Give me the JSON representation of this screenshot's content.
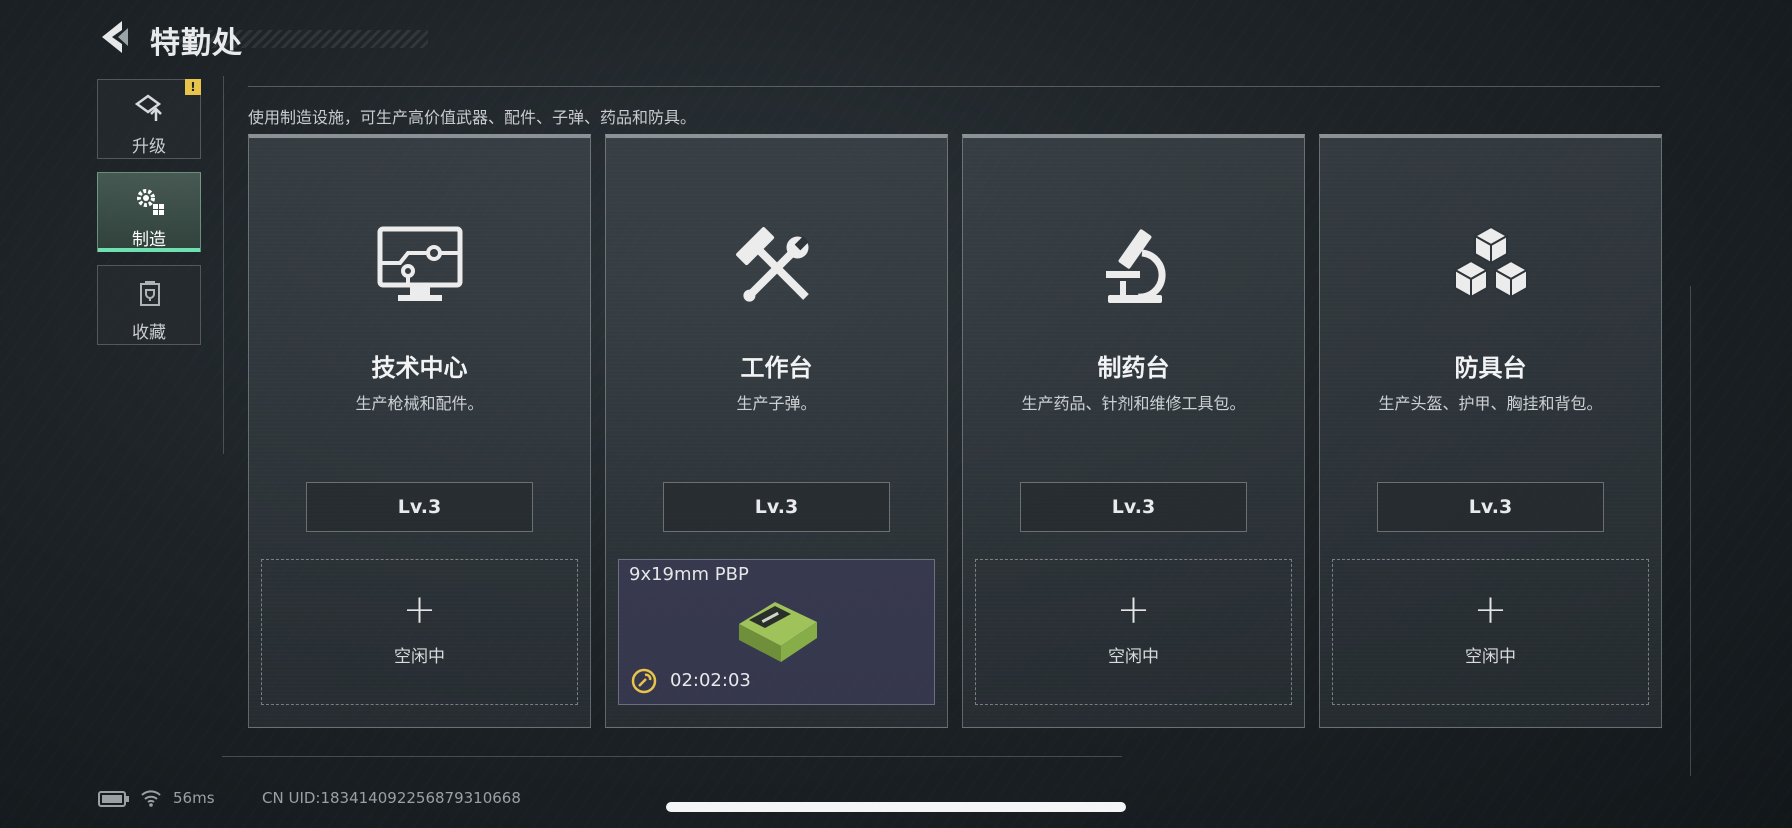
{
  "header": {
    "title": "特勤处"
  },
  "sidebar": {
    "items": [
      {
        "label": "升级",
        "icon": "upgrade-icon",
        "active": false,
        "badge": "!"
      },
      {
        "label": "制造",
        "icon": "gears-icon",
        "active": true
      },
      {
        "label": "收藏",
        "icon": "trophy-icon",
        "active": false
      }
    ]
  },
  "main": {
    "subtitle": "使用制造设施，可生产高价值武器、配件、子弹、药品和防具。",
    "stations": [
      {
        "title": "技术中心",
        "desc": "生产枪械和配件。",
        "level": "Lv.3",
        "icon": "monitor-circuit-icon",
        "slot": {
          "status": "idle",
          "plus": "+",
          "label": "空闲中"
        }
      },
      {
        "title": "工作台",
        "desc": "生产子弹。",
        "level": "Lv.3",
        "icon": "hammer-wrench-icon",
        "slot": {
          "status": "producing",
          "item": "9x19mm PBP",
          "timer": "02:02:03"
        }
      },
      {
        "title": "制药台",
        "desc": "生产药品、针剂和维修工具包。",
        "level": "Lv.3",
        "icon": "microscope-icon",
        "slot": {
          "status": "idle",
          "plus": "+",
          "label": "空闲中"
        }
      },
      {
        "title": "防具台",
        "desc": "生产头盔、护甲、胸挂和背包。",
        "level": "Lv.3",
        "icon": "cubes-icon",
        "slot": {
          "status": "idle",
          "plus": "+",
          "label": "空闲中"
        }
      }
    ]
  },
  "status_bar": {
    "ping": "56ms",
    "uid": "CN UID:183414092256879310668"
  },
  "colors": {
    "accent": "#6fe0b0",
    "warning": "#e8c44a",
    "producing_bg": "#3c3c58"
  }
}
